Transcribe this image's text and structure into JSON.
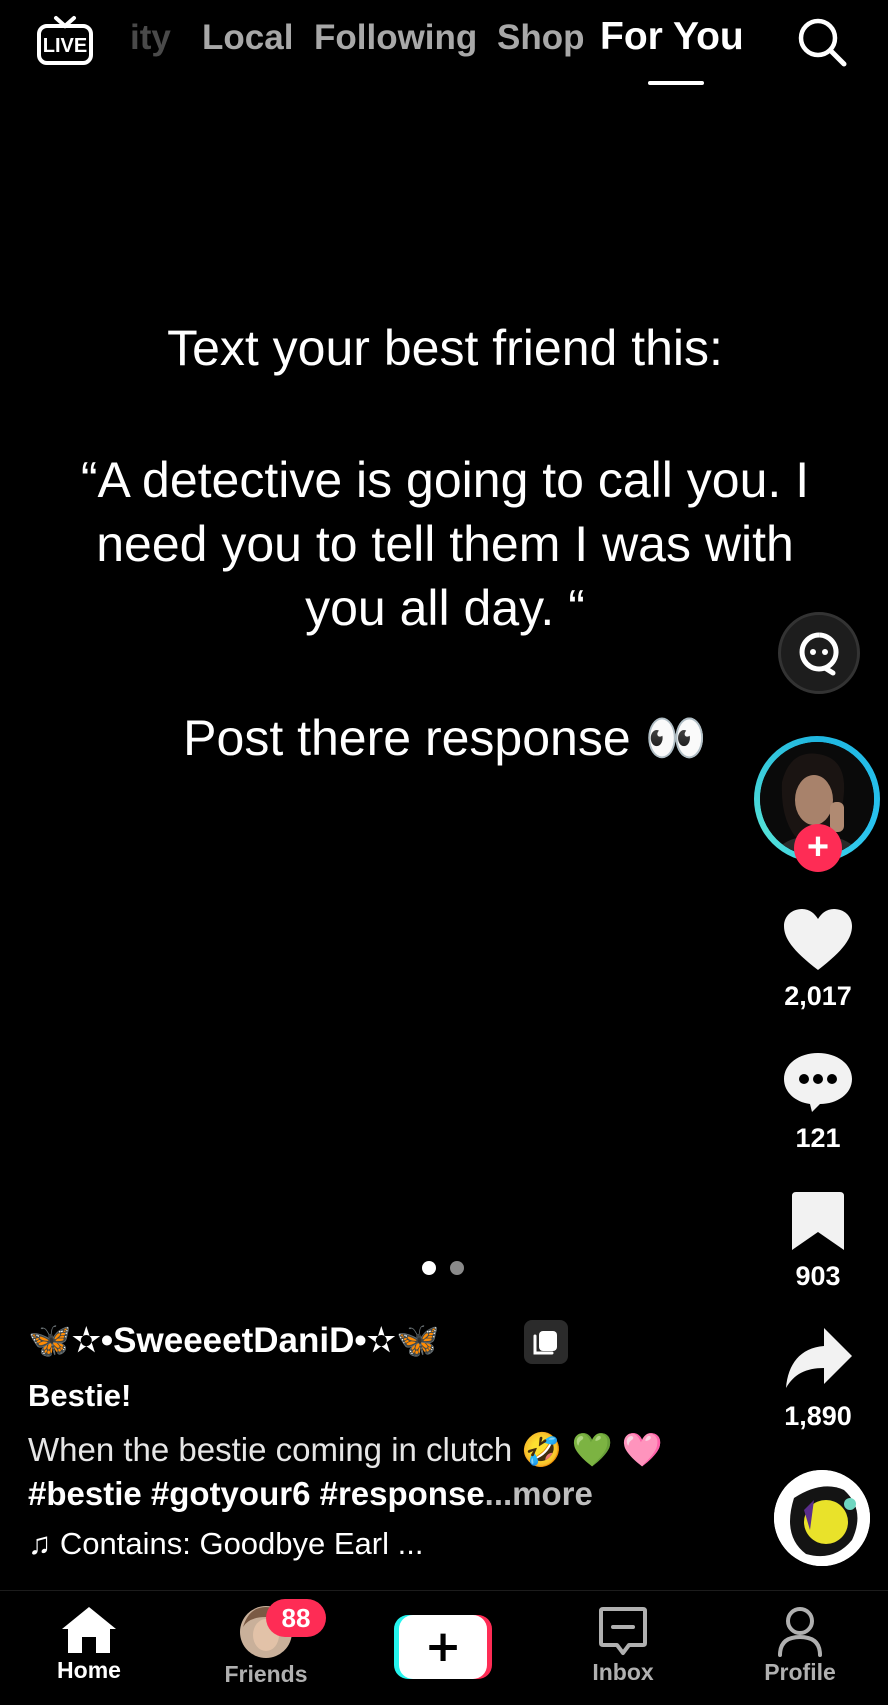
{
  "header": {
    "tabs": [
      {
        "label": "ity",
        "state": "faded"
      },
      {
        "label": "Local",
        "state": "inactive"
      },
      {
        "label": "Following",
        "state": "inactive"
      },
      {
        "label": "Shop",
        "state": "inactive"
      },
      {
        "label": "For You",
        "state": "active"
      }
    ],
    "live_icon": {
      "name": "live-tv-icon",
      "text": "LIVE"
    },
    "search_icon": "search-icon"
  },
  "video": {
    "caption_lines": [
      "Text your best friend this:",
      "“A detective is going to call you. I need you to tell them I was with you all day. “",
      "Post there response 👀"
    ]
  },
  "rail": {
    "likes": "2,017",
    "comments": "121",
    "saves": "903",
    "shares": "1,890",
    "follow_symbol": "+"
  },
  "post": {
    "username": "🦋✫•SweeeetDaniD•✫🦋",
    "title": "Bestie!",
    "description_text": "When the bestie coming in clutch 🤣 💚 🩷 ",
    "hashtags": "#bestie #gotyour6 #response",
    "more_label": "...more",
    "music": "Contains: Goodbye Earl ...",
    "music_symbol": "♫"
  },
  "pager": {
    "count": 2,
    "active_index": 0
  },
  "nav": {
    "home": "Home",
    "friends": "Friends",
    "friends_badge": "88",
    "create_symbol": "+",
    "inbox": "Inbox",
    "profile": "Profile"
  },
  "colors": {
    "accent_red": "#fe2c55",
    "accent_cyan": "#25f4ee",
    "ring": "#1fb6e0",
    "background": "#000000"
  }
}
